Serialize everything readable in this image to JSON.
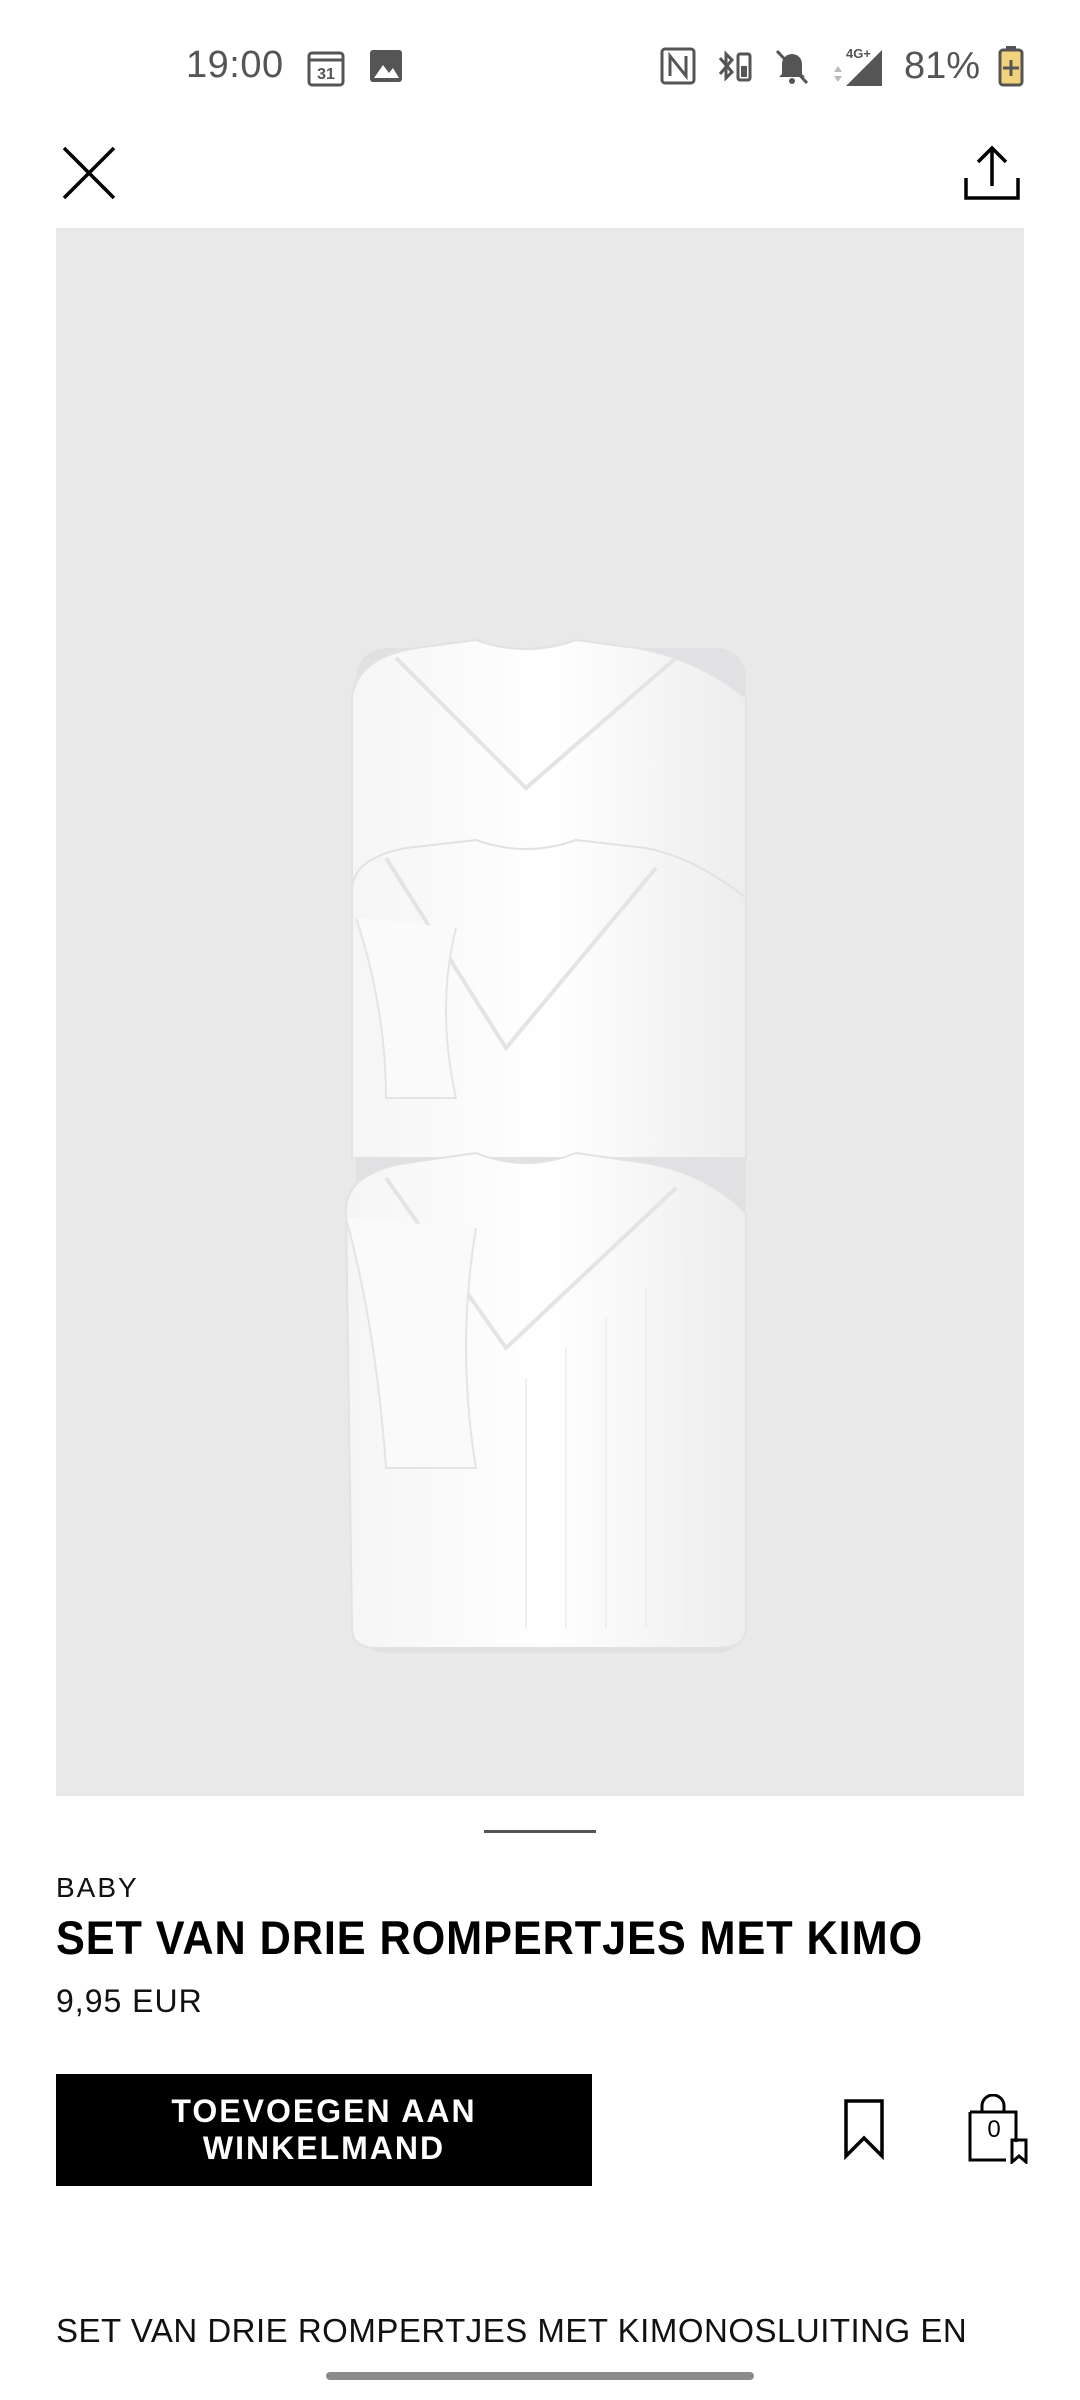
{
  "status_bar": {
    "time": "19:00",
    "calendar_day": "31",
    "network": "4G+",
    "battery_percent": "81%",
    "icons": [
      "calendar-icon",
      "gallery-icon",
      "nfc-icon",
      "bluetooth-battery-icon",
      "mute-icon",
      "signal-icon",
      "battery-charging-icon"
    ]
  },
  "toolbar": {
    "close_icon": "close-icon",
    "share_icon": "share-icon"
  },
  "gallery": {
    "image_count": 5,
    "active_index": 0,
    "background_color": "#e9e9ea"
  },
  "product": {
    "category": "BABY",
    "title": "SET VAN DRIE ROMPERTJES MET KIMON…",
    "price": "9,95 EUR",
    "add_to_cart_label": "TOEVOEGEN AAN WINKELMAND",
    "cart_count": "0",
    "description": "SET VAN DRIE ROMPERTJES MET KIMONOSLUITING EN"
  },
  "colors": {
    "primary": "#000000",
    "background": "#ffffff",
    "text_secondary": "#555555"
  }
}
